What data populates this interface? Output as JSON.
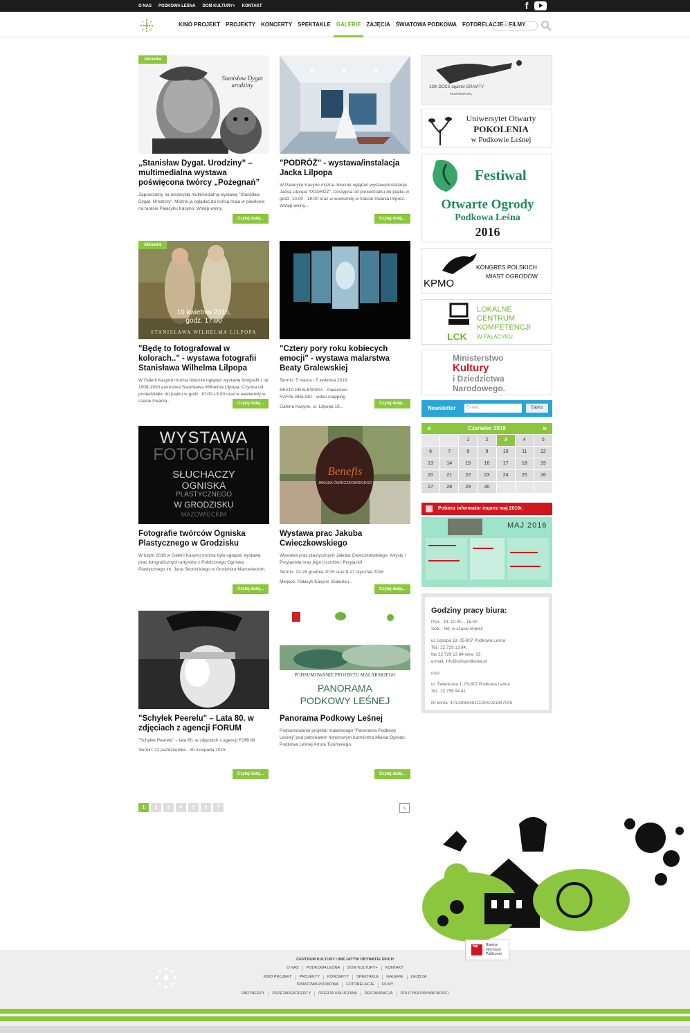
{
  "top_menu": [
    "O NAS",
    "PODKOWA LEŚNA",
    "DOM KULTURY+",
    "KONTAKT"
  ],
  "social": {
    "facebook": "f"
  },
  "nav": {
    "items": [
      "KINO PROJEKT",
      "PROJEKTY",
      "KONCERTY",
      "SPEKTAKLE",
      "GALERIE",
      "ZAJĘCIA",
      "ŚWIATOWA PODKOWA",
      "FOTORELACJE",
      "FILMY"
    ],
    "active": "GALERIE",
    "search_placeholder": "Szukaj..."
  },
  "cards": [
    {
      "badge": "Aktualne",
      "title": "„Stanisław Dygat. Urodziny” – multimedialna wystawa poświęcona twórcy „Pożegnań”",
      "desc": "Zapraszamy na niezwykłą multimedialną wystawę \"Stanisław Dygat. Urodziny\". Można ją oglądać do końca maja w pawilonie na tarasie Pałacyku Kasyno. Wstęp wolny.",
      "button": "Czytaj dalej...",
      "thumb_text": "Stanisław Dygat urodziny"
    },
    {
      "badge": "",
      "title": "\"PODRÓŻ\" - wystawa/instalacja Jacka Lilpopa",
      "desc": "W Pałacyku Kasyno można obecnie oglądać wystawę/instalację Jacka Lilpopa \"PODRÓŻ\". Dostępna od poniedziałku do piątku w godz. 10.00 - 18.00 oraz w weekendy w trakcie trwania imprez. Wstęp wolny...",
      "button": "Czytaj dalej..."
    },
    {
      "badge": "Aktualne",
      "title": "\"Będę to fotografował w kolorach..\" - wystawa fotografii Stanisława Wilhelma Lilpopa",
      "desc": "W Galerii Kasyno można obecnie oglądać wystawę fotografii z lat 1908-1930 autorstwa Stanisława Wilhelma Lilpopa. Czynna od poniedziałku do piątku w godz. 10.00-18.00 oraz w weekendy w czasie trwania...",
      "button": "Czytaj dalej...",
      "thumb_text": [
        "10 kwietnia 2016,",
        "godz. 17.00",
        "STANISŁAWA WILHELMA LILPOPA"
      ]
    },
    {
      "badge": "",
      "title": "\"Cztery pory roku kobiecych emocji\" - wystawa malarstwa Beaty Gralewskiej",
      "term": "Termin: 5 marca - 5 kwietnia 2016",
      "lines": [
        "BEATA GRALEWSKA - malarstwo",
        "RAFAŁ BIELSKI - video mapping"
      ],
      "place": "Galeria Kasyno, ul. Lilpopa 18...",
      "button": "Czytaj dalej..."
    },
    {
      "badge": "",
      "title": "Fotografie twórców Ogniska Plastycznego w Grodzisku",
      "desc": "W lutym 2016 w Galerii Kasyno można było oglądać wystawę prac fotograficznych artystów z Publicznego Ogniska Plastycznego im. Jana Skotnickiego w Grodzisku Mazowieckim.",
      "button": "Czytaj dalej...",
      "thumb_text": [
        "WYSTAWA",
        "FOTOGRAFII",
        "SŁUCHACZY",
        "OGNISKA",
        "PLASTYCZNEGO",
        "W GRODZISKU",
        "MAZOWIECKIM"
      ]
    },
    {
      "badge": "",
      "title": "Wystawa prac Jakuba Cwieczkowskiego",
      "desc": "Wystawa prac plastycznych Jakuba Ćwieczkowskiego, Artysty i Przyjaciela oraz jego Uczniów i Przyjaciół",
      "term": "Termin: 13-28 grudnia 2015 oraz 8-27 stycznia 2016",
      "place": "Miejsce: Pałacyk Kasyno (Galeria i...",
      "button": "Czytaj dalej...",
      "thumb_text": [
        "Benefis",
        "JAKUBA ĆWIECZKOWSKIEGO"
      ]
    },
    {
      "badge": "",
      "title": "\"Schyłek Peerelu\" – Lata 80. w zdjęciach z agencji FORUM",
      "desc": "\"Schyłek Peerelu\" – lata 80. w zdjęciach z agencji FORUM",
      "term": "Termin: 12 października - 30 listopada 2015",
      "button": "Czytaj dalej..."
    },
    {
      "badge": "",
      "title": "Panorama Podkowy Leśnej",
      "desc": "Podsumowanie projektu malarskiego \"Panorama Podkowy Leśnej\" pod patronatem honorowym burmistrza Miasta Ogrodu Podkowa Leśnej Artura Tusińskiego.",
      "button": "Czytaj dalej...",
      "thumb_text": [
        "PODSUMOWANIE PROJEKTU MALARSKIEGO",
        "PANORAMA",
        "PODKOWY LEŚNEJ"
      ]
    }
  ],
  "sidebar": {
    "banners": [
      {
        "text": [
          "13th DOCS against GRAVITY",
          "FILM FESTIVAL"
        ]
      },
      {
        "text": [
          "Uniwersytet Otwarty",
          "POKOLENIA",
          "w Podkowie Leśnej"
        ]
      },
      {
        "text": [
          "Festiwal",
          "Otwarte Ogrody",
          "Podkowa Leśna",
          "2016"
        ]
      },
      {
        "text": [
          "KPMO",
          "KONGRES POLSKICH",
          "MIAST OGRODÓW"
        ]
      },
      {
        "text": [
          "LOKALNE",
          "CENTRUM",
          "KOMPETENCJI",
          "LCK",
          "W PAŁACYKU"
        ]
      },
      {
        "text": [
          "Ministerstwo",
          "Kultury",
          "i Dziedzictwa",
          "Narodowego."
        ]
      }
    ],
    "newsletter": {
      "label": "Newsletter",
      "placeholder": "E-mail...",
      "button": "Zapisz"
    },
    "calendar": {
      "month": "Czerwiec 2016",
      "days": [
        "",
        "",
        "1",
        "2",
        "3",
        "4",
        "5",
        "6",
        "7",
        "8",
        "9",
        "10",
        "11",
        "12",
        "13",
        "14",
        "15",
        "16",
        "17",
        "18",
        "19",
        "20",
        "21",
        "22",
        "23",
        "24",
        "25",
        "26",
        "27",
        "28",
        "29",
        "30",
        "",
        "",
        ""
      ],
      "today": "3"
    },
    "informator": {
      "label": "Pobierz informator imprez maj 2016r.",
      "poster_title": "MAJ 2016"
    },
    "hours": {
      "title": "Godziny pracy biura:",
      "lines": [
        "Pon. - Pt.  10.00 – 18.00",
        "Sob. - Nd.  w czasie imprez",
        "",
        "ul. Lilpopa 18, 05-807 Podkowa Leśna",
        "Tel.: 22 729 13 84,",
        "fax 22 729 13 84 wew. 33",
        "e-mail: info@cklopodkowa.pl",
        "",
        "oraz",
        "",
        "ul. Świerkowa 1, 05-807 Podkowa Leśna",
        "Tel.: 22 758 94 41",
        "",
        "Nr konta: 47124063481111001021847049"
      ]
    }
  },
  "pagination": {
    "pages": [
      "1",
      "2",
      "3",
      "4",
      "5",
      "6",
      "7"
    ],
    "current": "1",
    "next": "›"
  },
  "footer": {
    "org": "CENTRUM KULTURY I INICJATYW OBYWATELSKICH",
    "row1": [
      "O NAS",
      "PODKOWA LEŚNA",
      "DOM KULTURY+",
      "KONTAKT"
    ],
    "row2": [
      "KINO PROJEKT",
      "PROJEKTY",
      "KONCERTY",
      "SPEKTAKLE",
      "GALERIE",
      "ZAJĘCIA"
    ],
    "row3": [
      "ŚWIATOWA PODKOWA",
      "FOTORELACJE",
      "FILMY"
    ],
    "row4": [
      "PARTNERZY",
      "PRZETARGI/OFERTY",
      "OFERTA USŁUGOWA",
      "RESTAURACJA",
      "POLITYKA PRYWATNOŚCI"
    ],
    "bip": [
      "Biuletyn",
      "Informacji",
      "Publicznej"
    ],
    "bip_mark": "bip"
  },
  "colors": {
    "accent": "#8cc63f",
    "newsletter": "#29a6d9",
    "info": "#d0161f"
  }
}
